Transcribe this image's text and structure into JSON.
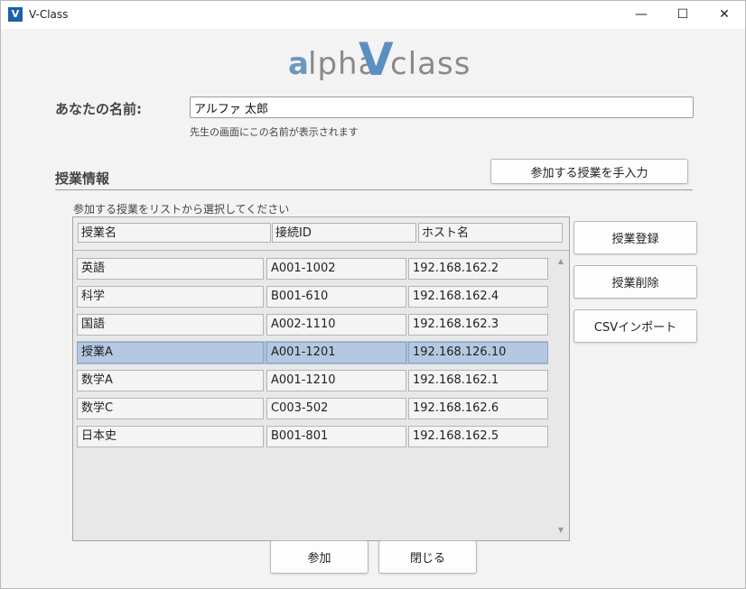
{
  "window": {
    "title": "V-Class",
    "icon_text": "V",
    "icon": "app-logo-icon"
  },
  "controls": {
    "minimize": "—",
    "maximize": "☐",
    "close": "✕"
  },
  "logo": {
    "a": "a",
    "lpha": "lpha",
    "v": "V",
    "class": "class"
  },
  "name": {
    "label": "あなたの名前:",
    "value": "アルファ 太郎",
    "hint": "先生の画面にこの名前が表示されます"
  },
  "lesson": {
    "section_title": "授業情報",
    "manual_button": "参加する授業を手入力",
    "list_hint": "参加する授業をリストから選択してください",
    "columns": [
      "授業名",
      "接続ID",
      "ホスト名"
    ],
    "rows": [
      {
        "name": "英語",
        "id": "A001-1002",
        "host": "192.168.162.2",
        "selected": false
      },
      {
        "name": "科学",
        "id": "B001-610",
        "host": "192.168.162.4",
        "selected": false
      },
      {
        "name": "国語",
        "id": "A002-1110",
        "host": "192.168.162.3",
        "selected": false
      },
      {
        "name": "授業A",
        "id": "A001-1201",
        "host": "192.168.126.10",
        "selected": true
      },
      {
        "name": "数学A",
        "id": "A001-1210",
        "host": "192.168.162.1",
        "selected": false
      },
      {
        "name": "数学C",
        "id": "C003-502",
        "host": "192.168.162.6",
        "selected": false
      },
      {
        "name": "日本史",
        "id": "B001-801",
        "host": "192.168.162.5",
        "selected": false
      }
    ]
  },
  "side_buttons": {
    "register": "授業登録",
    "delete": "授業削除",
    "csv_import": "CSVインポート"
  },
  "bottom_buttons": {
    "join": "参加",
    "close": "閉じる"
  },
  "colors": {
    "selected_row": "#a9bfdb",
    "logo_blue": "#5b8fc1",
    "logo_gray": "#8a8a8a"
  }
}
